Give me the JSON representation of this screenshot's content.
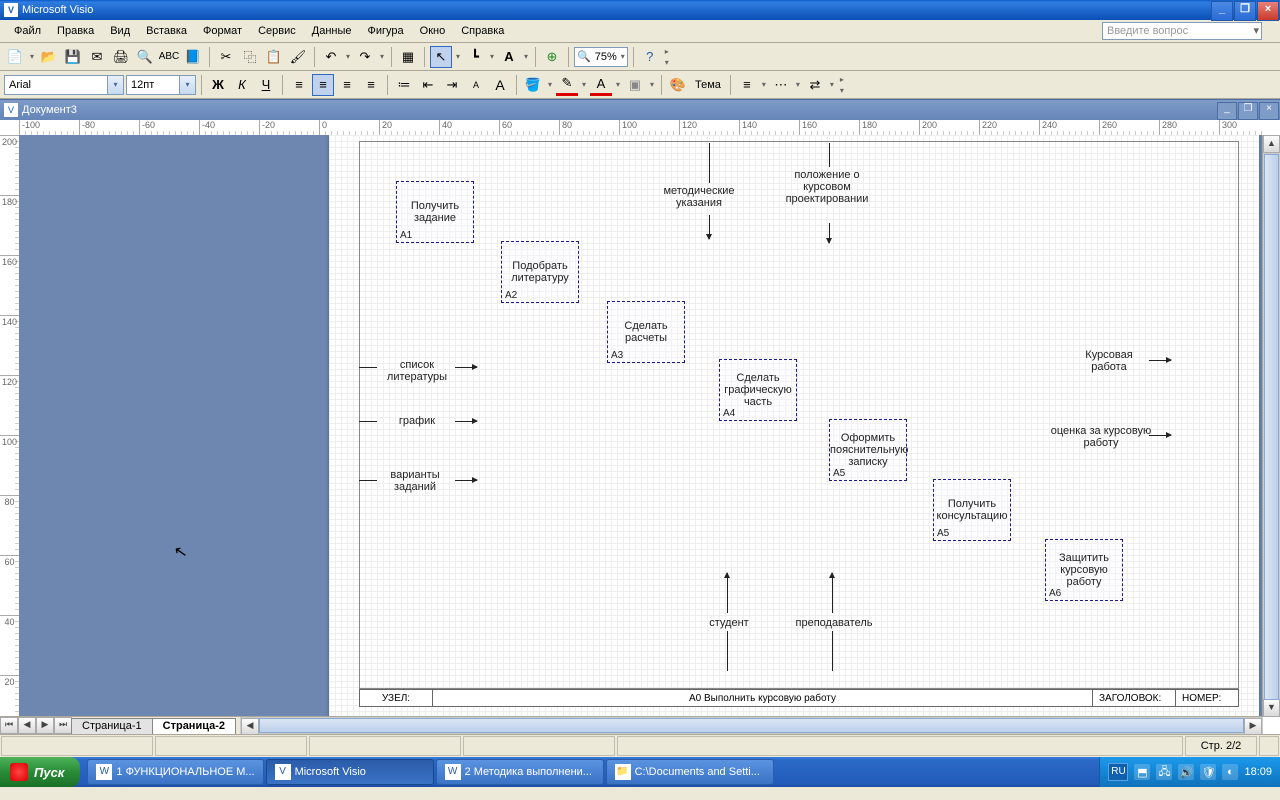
{
  "app_title": "Microsoft Visio",
  "doc_title": "Документ3",
  "ask_placeholder": "Введите вопрос",
  "menu": [
    "Файл",
    "Правка",
    "Вид",
    "Вставка",
    "Формат",
    "Сервис",
    "Данные",
    "Фигура",
    "Окно",
    "Справка"
  ],
  "zoom": "75%",
  "font_name": "Arial",
  "font_size": "12пт",
  "theme_label": "Тема",
  "ruler_h": [
    "-100",
    "-80",
    "-60",
    "-40",
    "-20",
    "0",
    "20",
    "40",
    "60",
    "80",
    "100",
    "120",
    "140",
    "160",
    "180",
    "200",
    "220",
    "240",
    "260",
    "280",
    "300"
  ],
  "ruler_v": [
    "200",
    "180",
    "160",
    "140",
    "120",
    "100",
    "80",
    "60",
    "40",
    "20"
  ],
  "blocks": {
    "a1": {
      "t": "Получить задание",
      "id": "А1"
    },
    "a2": {
      "t": "Подобрать литературу",
      "id": "А2"
    },
    "a3": {
      "t": "Сделать расчеты",
      "id": "А3"
    },
    "a4": {
      "t": "Сделать графическую часть",
      "id": "А4"
    },
    "a5": {
      "t": "Оформить пояснительную записку",
      "id": "А5"
    },
    "a5b": {
      "t": "Получить консультацию",
      "id": "А5"
    },
    "a6": {
      "t": "Защитить курсовую работу",
      "id": "А6"
    }
  },
  "labels": {
    "metod": "методические указания",
    "poloz": "положение о курсовом проектировании",
    "spisok": "список литературы",
    "grafik": "график",
    "variant": "варианты заданий",
    "kurs": "Курсовая работа",
    "ocenka": "оценка за курсовую работу",
    "student": "студент",
    "prepod": "преподаватель"
  },
  "footer": {
    "uzel": "УЗЕЛ:",
    "center": "А0 Выполнить курсовую работу",
    "zag": "ЗАГОЛОВОК:",
    "nomer": "НОМЕР:"
  },
  "tabs": [
    "Страница-1",
    "Страница-2"
  ],
  "status_page": "Стр. 2/2",
  "taskbar": {
    "start": "Пуск",
    "btns": [
      {
        "t": "1 ФУНКЦИОНАЛЬНОЕ М..."
      },
      {
        "t": "Microsoft Visio"
      },
      {
        "t": "2 Методика выполнени..."
      },
      {
        "t": "C:\\Documents and Setti..."
      }
    ],
    "lang": "RU",
    "time": "18:09"
  }
}
